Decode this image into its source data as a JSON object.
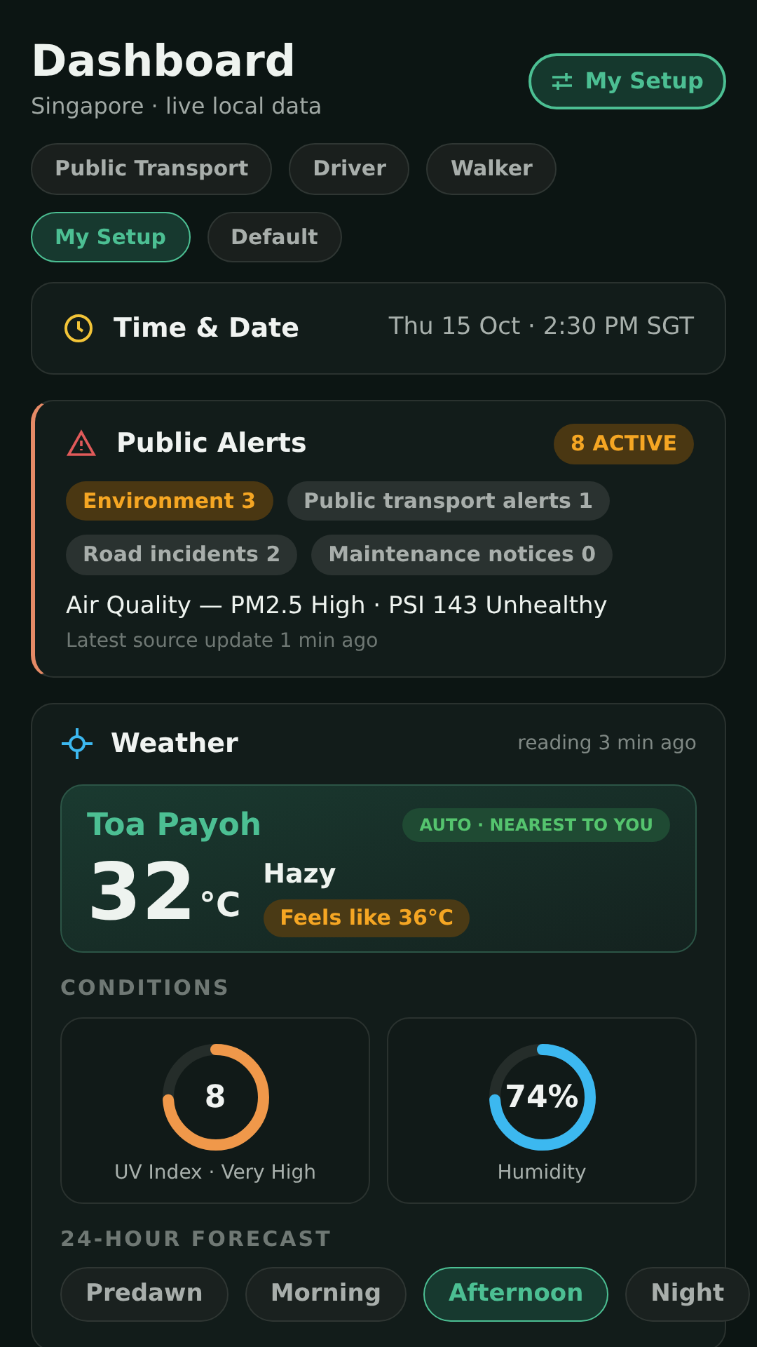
{
  "header": {
    "title": "Dashboard",
    "subtitle": "Singapore · live local data",
    "setup_button": "My Setup"
  },
  "profiles": [
    {
      "label": "Public Transport",
      "selected": false
    },
    {
      "label": "Driver",
      "selected": false
    },
    {
      "label": "Walker",
      "selected": false
    },
    {
      "label": "My Setup",
      "selected": true
    },
    {
      "label": "Default",
      "selected": false
    }
  ],
  "time_card": {
    "title": "Time & Date",
    "value": "Thu 15 Oct · 2:30 PM SGT"
  },
  "alerts": {
    "title": "Public Alerts",
    "badge": "8 ACTIVE",
    "categories": [
      {
        "label": "Environment 3",
        "highlighted": true
      },
      {
        "label": "Public transport alerts 1",
        "highlighted": false
      },
      {
        "label": "Road incidents 2",
        "highlighted": false
      },
      {
        "label": "Maintenance notices 0",
        "highlighted": false
      }
    ],
    "headline": "Air Quality — PM2.5 High · PSI 143 Unhealthy",
    "updated": "Latest source update 1 min ago"
  },
  "weather": {
    "title": "Weather",
    "updated": "reading 3 min ago",
    "location": {
      "name": "Toa Payoh",
      "badge": "AUTO · NEAREST TO YOU",
      "temperature": "32",
      "unit": "°C",
      "condition": "Hazy",
      "feels_like": "Feels like 36°C"
    },
    "conditions_heading": "CONDITIONS",
    "conditions": [
      {
        "value": "8",
        "label": "UV Index · Very High",
        "color": "#f0984a"
      },
      {
        "value": "74%",
        "label": "Humidity",
        "color": "#3cb8f0"
      }
    ],
    "forecast_heading": "24-HOUR FORECAST",
    "forecast_tabs": [
      {
        "label": "Predawn",
        "selected": false
      },
      {
        "label": "Morning",
        "selected": false
      },
      {
        "label": "Afternoon",
        "selected": true
      },
      {
        "label": "Night",
        "selected": false
      }
    ]
  }
}
